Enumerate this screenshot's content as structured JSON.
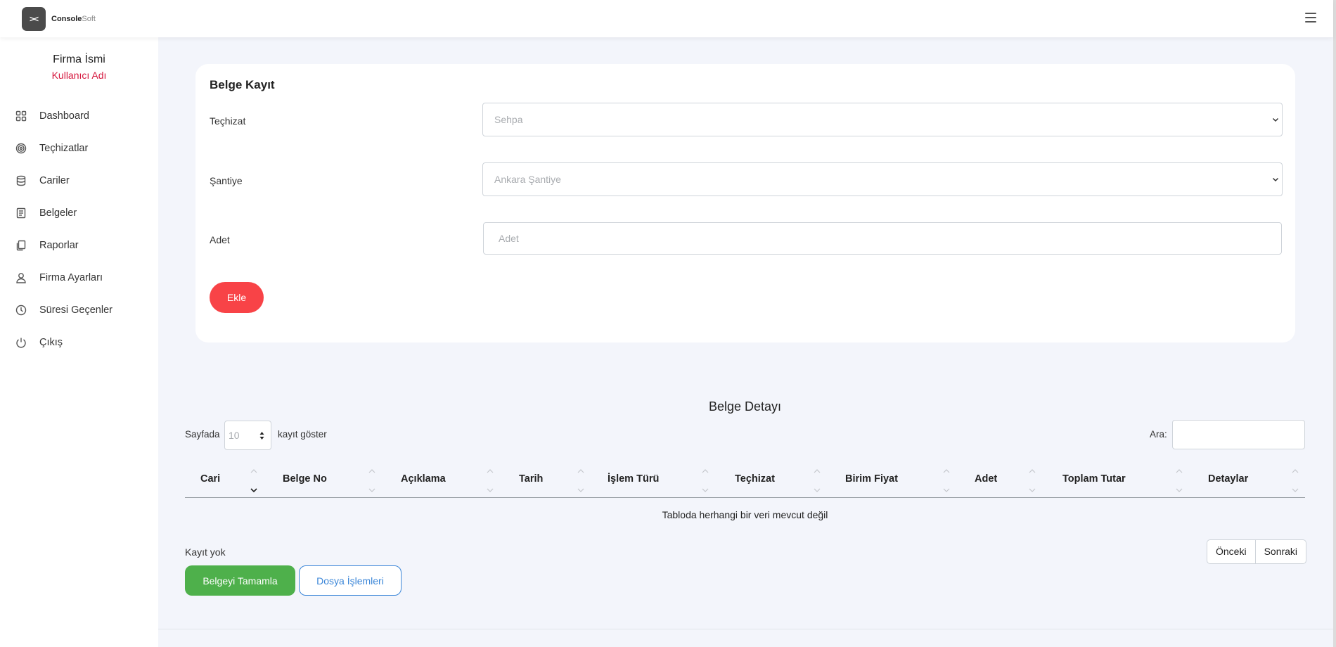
{
  "header": {
    "logo_glyph": "><",
    "brand_bold": "Console",
    "brand_light": "Soft"
  },
  "sidebar": {
    "company": "Firma İsmi",
    "user": "Kullanıcı Adı",
    "items": [
      {
        "label": "Dashboard",
        "icon": "grid-icon"
      },
      {
        "label": "Teçhizatlar",
        "icon": "target-icon"
      },
      {
        "label": "Cariler",
        "icon": "database-icon"
      },
      {
        "label": "Belgeler",
        "icon": "document-icon"
      },
      {
        "label": "Raporlar",
        "icon": "copy-icon"
      },
      {
        "label": "Firma Ayarları",
        "icon": "user-icon"
      },
      {
        "label": "Süresi Geçenler",
        "icon": "clock-icon"
      },
      {
        "label": "Çıkış",
        "icon": "power-icon"
      }
    ]
  },
  "form": {
    "title": "Belge Kayıt",
    "equipment_label": "Teçhizat",
    "equipment_value": "Sehpa",
    "site_label": "Şantiye",
    "site_value": "Ankara Şantiye",
    "quantity_label": "Adet",
    "quantity_placeholder": "Adet",
    "add_button": "Ekle"
  },
  "details": {
    "title": "Belge Detayı",
    "length_before": "Sayfada",
    "length_value": "10",
    "length_after": "kayıt göster",
    "search_label": "Ara:",
    "columns": [
      "Cari",
      "Belge No",
      "Açıklama",
      "Tarih",
      "İşlem Türü",
      "Teçhizat",
      "Birim Fiyat",
      "Adet",
      "Toplam Tutar",
      "Detaylar"
    ],
    "empty_message": "Tabloda herhangi bir veri mevcut değil",
    "info": "Kayıt yok",
    "prev": "Önceki",
    "next": "Sonraki",
    "complete_button": "Belgeyi Tamamla",
    "file_button": "Dosya İşlemleri"
  },
  "colors": {
    "accent_red": "#f84347",
    "user_red": "#d6193f",
    "green": "#4eb04b",
    "blue": "#3b86d8"
  }
}
